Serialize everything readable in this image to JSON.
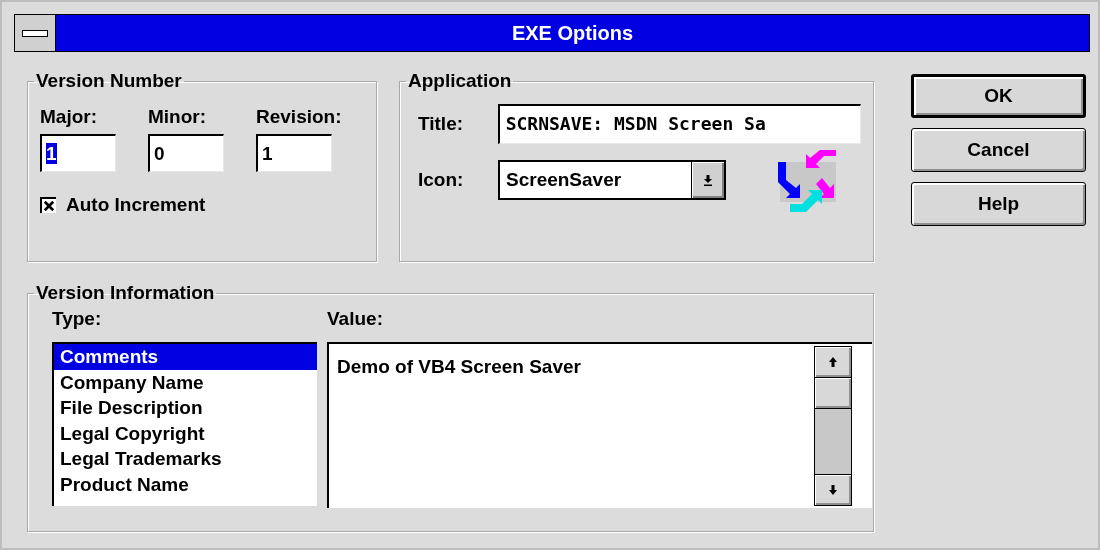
{
  "window": {
    "title": "EXE Options"
  },
  "version_number": {
    "label": "Version Number",
    "fields": [
      {
        "label": "Major:",
        "value": "1",
        "text_selected": true
      },
      {
        "label": "Minor:",
        "value": "0",
        "text_selected": false
      },
      {
        "label": "Revision:",
        "value": "1",
        "text_selected": false
      }
    ],
    "auto_increment": {
      "label": "Auto Increment",
      "checked": true
    }
  },
  "application": {
    "label": "Application",
    "title": {
      "label": "Title:",
      "value": "SCRNSAVE: MSDN Screen Sa"
    },
    "icon": {
      "label": "Icon:",
      "value": "ScreenSaver"
    }
  },
  "version_information": {
    "label": "Version Information",
    "type": {
      "label": "Type:",
      "items": [
        {
          "text": "Comments",
          "selected": true
        },
        {
          "text": "Company Name",
          "selected": false
        },
        {
          "text": "File Description",
          "selected": false
        },
        {
          "text": "Legal Copyright",
          "selected": false
        },
        {
          "text": "Legal Trademarks",
          "selected": false
        },
        {
          "text": "Product Name",
          "selected": false
        }
      ]
    },
    "value": {
      "label": "Value:",
      "text": "Demo of VB4 Screen Saver"
    }
  },
  "buttons": [
    {
      "label": "OK",
      "default": true
    },
    {
      "label": "Cancel",
      "default": false
    },
    {
      "label": "Help",
      "default": false
    }
  ]
}
